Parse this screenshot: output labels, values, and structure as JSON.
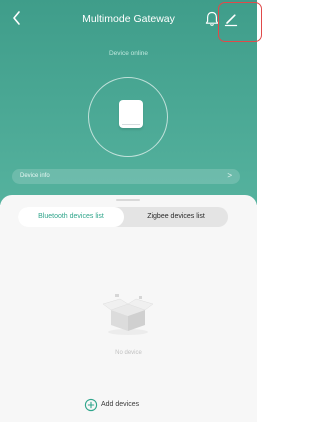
{
  "header": {
    "title": "Multimode Gateway",
    "back_icon": "chevron-left-icon",
    "bell_icon": "bell-icon",
    "edit_icon": "pencil-icon"
  },
  "device": {
    "status": "Device online",
    "info_label": "Device info",
    "info_chevron": ">"
  },
  "tabs": {
    "bluetooth": "Bluetooth devices list",
    "zigbee": "Zigbee devices list",
    "active": "bluetooth"
  },
  "empty": {
    "text": "No device",
    "illustration_icon": "empty-box-icon"
  },
  "actions": {
    "add_label": "Add devices",
    "add_icon": "plus-circle-icon"
  },
  "colors": {
    "accent": "#2fa58b",
    "hero_top": "#3f9d8a",
    "hero_bottom": "#55b29e",
    "highlight": "#e04a4a"
  }
}
